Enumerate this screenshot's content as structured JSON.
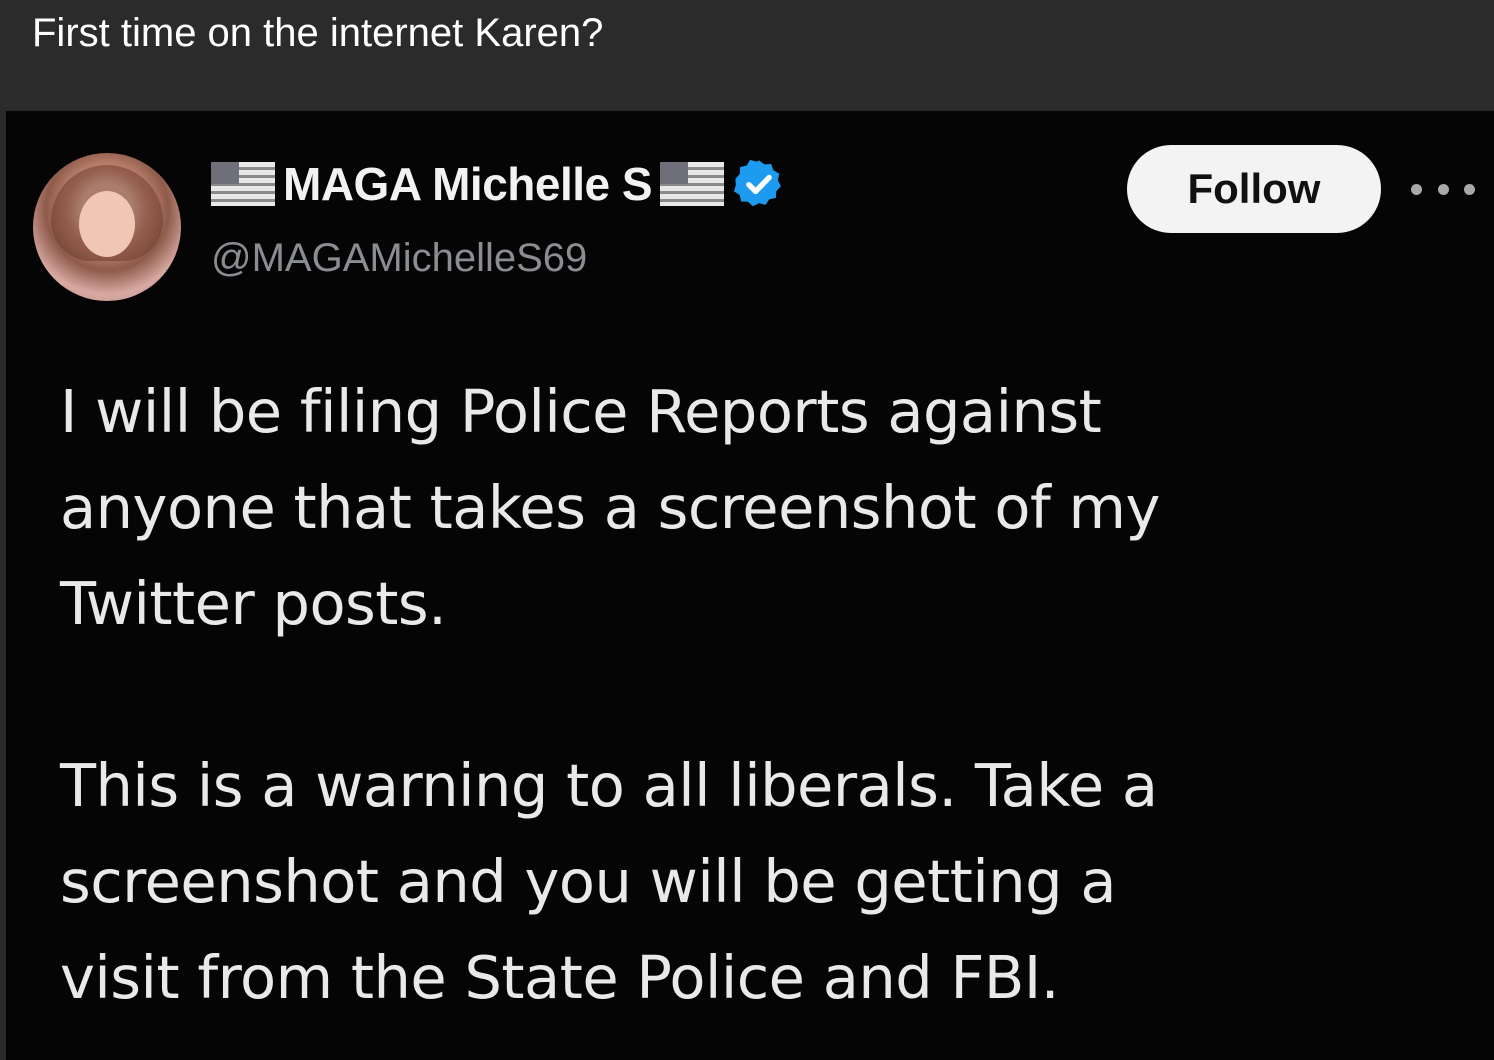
{
  "caption": "First time on the internet Karen?",
  "tweet": {
    "display_name": "MAGA Michelle S",
    "handle": "@MAGAMichelleS69",
    "follow_label": "Follow",
    "paragraph_1": "I will be filing Police Reports against\nanyone that takes a screenshot of my\nTwitter posts.",
    "paragraph_2": "This is a warning to all liberals. Take a\nscreenshot and you will be getting a\nvisit from the State Police and FBI."
  },
  "icons": {
    "flag_left": "us-flag-icon",
    "flag_right": "us-flag-icon",
    "verified": "verified-badge-icon",
    "more": "more-options-icon"
  },
  "colors": {
    "caption_bar": "#2b2b2b",
    "tweet_background": "#050505",
    "verified_blue": "#1d9bf0",
    "follow_button": "#f3f3f3"
  }
}
